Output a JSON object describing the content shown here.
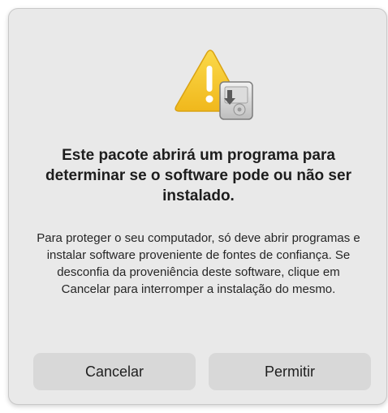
{
  "dialog": {
    "icon": "warning-triangle-with-installer-disk-icon",
    "title": "Este pacote abrirá um programa para determinar se o software pode ou não ser instalado.",
    "message": "Para proteger o seu computador, só deve abrir programas e instalar software proveniente de fontes de confiança. Se desconfia da proveniência deste software, clique em Cancelar para interromper a instalação do mesmo.",
    "buttons": {
      "cancel_label": "Cancelar",
      "allow_label": "Permitir"
    }
  },
  "colors": {
    "warning_yellow": "#f5c530",
    "dialog_background": "#e9e9e9",
    "button_background": "#d8d8d8"
  }
}
